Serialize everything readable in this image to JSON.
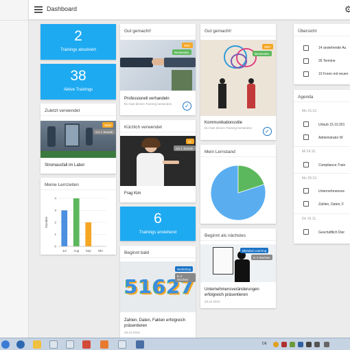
{
  "topbar": {
    "title": "Dashboard"
  },
  "stats": [
    {
      "value": "2",
      "label": "Trainings absolviert"
    },
    {
      "value": "38",
      "label": "Aktive Trainings"
    },
    {
      "value": "6",
      "label": "Trainings anstehend"
    }
  ],
  "recent": {
    "header": "Zuletzt verwendet",
    "caption": "Stromausfall im Labor",
    "badge1": "Spiel",
    "badge2": "vor 1 Stunde"
  },
  "times": {
    "header": "Meine Lernzeiten",
    "ylabel": "Stunden"
  },
  "chart_data": [
    {
      "type": "bar",
      "categories": [
        "Jul",
        "Aug",
        "Sep",
        "Okt"
      ],
      "values": [
        3,
        4,
        2,
        0
      ],
      "colors": [
        "#4a8fe0",
        "#5cb85c",
        "#f5a623",
        "#999999"
      ],
      "xlabel": "",
      "ylabel": "Stunden",
      "ylim": [
        0,
        4
      ],
      "yticks": [
        "0",
        "1",
        "2",
        "3",
        "4"
      ]
    },
    {
      "type": "pie",
      "values": [
        80,
        20
      ],
      "colors": [
        "#5aaef0",
        "#5cb85c"
      ]
    }
  ],
  "card_pro": {
    "header": "Gut gemacht!",
    "caption": "Professionell verhandeln",
    "sub": "Du hast dieses Training bestanden",
    "badge1": "WBT",
    "badge2": "Bestanden"
  },
  "card_recent2": {
    "header": "Kürzlich verwendet",
    "caption": "Frag Kim",
    "badge1": "VL",
    "badge2": "vor 1 Stunde"
  },
  "card_soon": {
    "header": "Beginnt bald",
    "caption": "Zahlen, Daten, Fakten erfolgreich präsentieren",
    "date": "28.10.2018",
    "badge1": "Workshop",
    "badge2": "in 2 Wochen",
    "image_text": "51627"
  },
  "card_comm": {
    "header": "Gut gemacht!",
    "caption": "Kommunikationsstile",
    "sub": "Du hast dieses Training bestanden",
    "badge1": "WBT",
    "badge2": "Bestanden"
  },
  "card_level": {
    "header": "Mein Lernstand"
  },
  "card_next": {
    "header": "Beginnt als nächstes",
    "caption": "Unternehmensveränderungen erfolgreich präsentieren",
    "date": "28.10.2018",
    "badge1": "Blended Learning",
    "badge2": "in 2 Wochen"
  },
  "overview": {
    "header": "Übersicht",
    "items": [
      {
        "label": "14 anstehende Au"
      },
      {
        "label": "26 Termine"
      },
      {
        "label": "10 Foren mit neuen"
      }
    ]
  },
  "agenda": {
    "header": "Agenda",
    "days": [
      {
        "date": "Mo 15.10.",
        "items": [
          "Urlaub 15.10.201",
          "Administrator W"
        ]
      },
      {
        "date": "Mi 24.10.",
        "items": [
          "Compliance-Train"
        ]
      },
      {
        "date": "Mo 29.10.",
        "items": [
          "Unternehmensve",
          "Zahlen, Daten, F"
        ]
      },
      {
        "date": "Do 15.11.",
        "items": [
          "Geschäftlich Dier"
        ]
      }
    ]
  },
  "taskbar": {
    "lang": "DE"
  }
}
